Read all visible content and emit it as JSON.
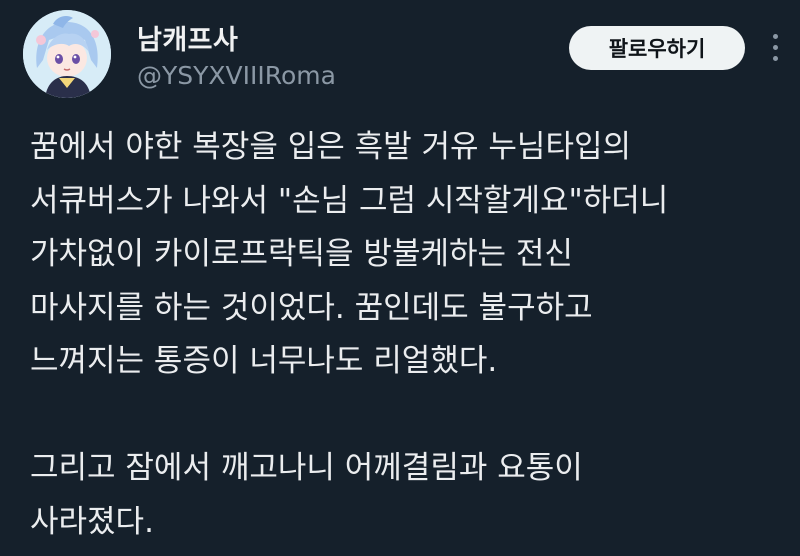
{
  "header": {
    "display_name": "남캐프사",
    "handle": "@YSYXVIIIRoma",
    "follow_label": "팔로우하기",
    "avatar_icon": "anime-character-avatar",
    "more_icon": "more-options-icon"
  },
  "tweet": {
    "lines": [
      "꿈에서 야한 복장을 입은 흑발 거유 누님타입의",
      "서큐버스가 나와서 \"손님 그럼 시작할게요\"하더니",
      "가차없이 카이로프락틱을 방불케하는 전신",
      "마사지를 하는 것이었다. 꿈인데도 불구하고",
      "느껴지는 통증이 너무나도 리얼했다.",
      "",
      "그리고 잠에서 깨고나니 어께결림과 요통이",
      "사라졌다."
    ]
  },
  "colors": {
    "background": "#15202b",
    "text": "#e7e9ea",
    "secondary_text": "#8b98a5",
    "follow_button_bg": "#eff3f4"
  }
}
